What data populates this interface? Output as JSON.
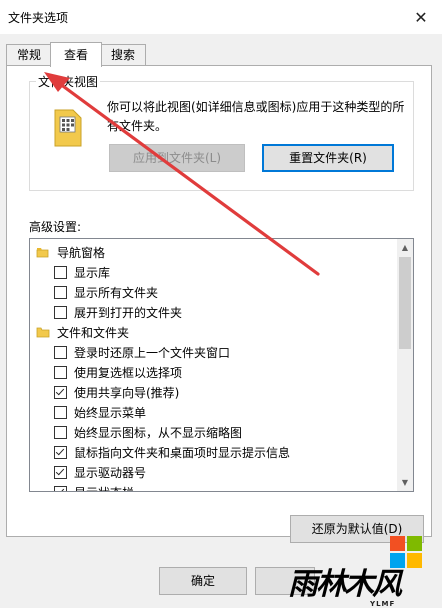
{
  "window": {
    "title": "文件夹选项",
    "close_glyph": "✕"
  },
  "tabs": [
    {
      "label": "常规"
    },
    {
      "label": "查看"
    },
    {
      "label": "搜索"
    }
  ],
  "folder_views": {
    "label": "文件夹视图",
    "description": "你可以将此视图(如详细信息或图标)应用于这种类型的所有文件夹。",
    "apply_button": "应用到文件夹(L)",
    "reset_button": "重置文件夹(R)"
  },
  "advanced": {
    "label": "高级设置:",
    "items": [
      {
        "type": "category",
        "label": "导航窗格",
        "icon": "navigation-pane-icon"
      },
      {
        "type": "option",
        "label": "显示库",
        "checked": false
      },
      {
        "type": "option",
        "label": "显示所有文件夹",
        "checked": false
      },
      {
        "type": "option",
        "label": "展开到打开的文件夹",
        "checked": false
      },
      {
        "type": "category",
        "label": "文件和文件夹",
        "icon": "folder-icon"
      },
      {
        "type": "option",
        "label": "登录时还原上一个文件夹窗口",
        "checked": false
      },
      {
        "type": "option",
        "label": "使用复选框以选择项",
        "checked": false
      },
      {
        "type": "option",
        "label": "使用共享向导(推荐)",
        "checked": true
      },
      {
        "type": "option",
        "label": "始终显示菜单",
        "checked": false
      },
      {
        "type": "option",
        "label": "始终显示图标，从不显示缩略图",
        "checked": false
      },
      {
        "type": "option",
        "label": "鼠标指向文件夹和桌面项时显示提示信息",
        "checked": true
      },
      {
        "type": "option",
        "label": "显示驱动器号",
        "checked": true
      },
      {
        "type": "option",
        "label": "显示状态栏",
        "checked": true
      }
    ],
    "restore_defaults_button": "还原为默认值(D)"
  },
  "footer": {
    "ok_button": "确定"
  },
  "watermark": {
    "text": "雨林木风",
    "subtext": "YLMF"
  },
  "colors": {
    "accent": "#0078d7",
    "annotation_arrow": "#e03c3c",
    "folder": "#f2c94c"
  }
}
